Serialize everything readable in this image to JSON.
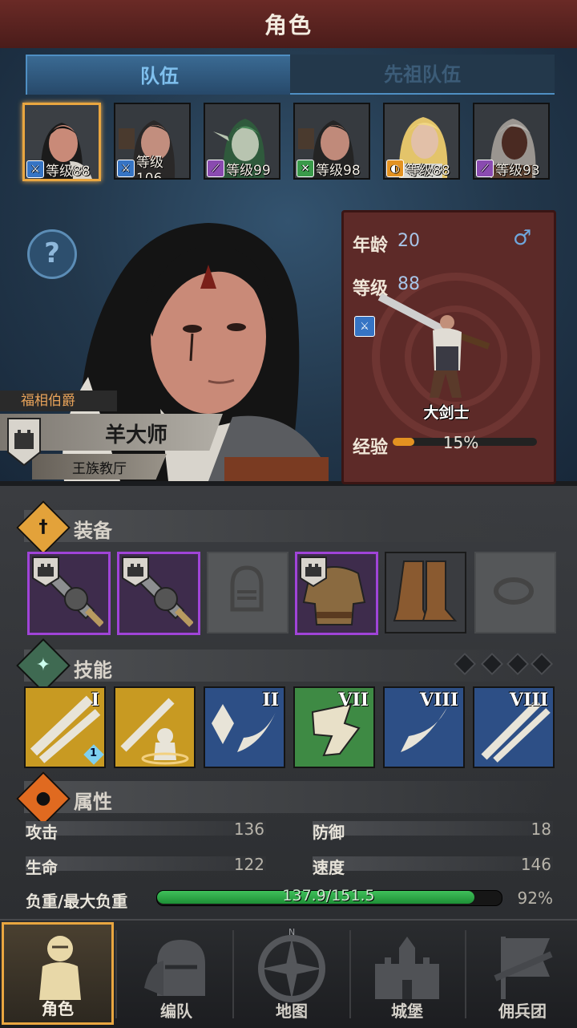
{
  "header": {
    "title": "角色"
  },
  "tabs": [
    {
      "label": "队伍",
      "active": true
    },
    {
      "label": "先祖队伍",
      "active": false
    }
  ],
  "party": [
    {
      "level_text": "等级88",
      "class_icon": "sword-icon",
      "class_color": "blue",
      "selected": true
    },
    {
      "level_text": "等级106",
      "class_icon": "sword-icon",
      "class_color": "blue",
      "selected": false
    },
    {
      "level_text": "等级99",
      "class_icon": "staff-icon",
      "class_color": "purple",
      "selected": false
    },
    {
      "level_text": "等级98",
      "class_icon": "crossed-swords-icon",
      "class_color": "green",
      "selected": false
    },
    {
      "level_text": "等级88",
      "class_icon": "shield-icon",
      "class_color": "orange",
      "selected": false
    },
    {
      "level_text": "等级93",
      "class_icon": "staff-icon",
      "class_color": "purple",
      "selected": false
    }
  ],
  "character": {
    "title": "福相伯爵",
    "name": "羊大师",
    "house": "王族教厅",
    "age_label": "年龄",
    "age": "20",
    "gender_icon": "male-icon",
    "level_label": "等级",
    "level": "88",
    "class_name": "大剑士",
    "exp_label": "经验",
    "exp_percent": "15%",
    "exp_fraction": 0.15
  },
  "equipment": {
    "label": "装备",
    "slots": [
      {
        "name": "greatsword",
        "rarity": "purple",
        "crest": true
      },
      {
        "name": "greatsword",
        "rarity": "purple",
        "crest": true
      },
      {
        "name": "helmet-empty",
        "rarity": "empty",
        "crest": false
      },
      {
        "name": "leather-armor",
        "rarity": "purple",
        "crest": true
      },
      {
        "name": "boots",
        "rarity": "normal",
        "crest": false
      },
      {
        "name": "ring-empty",
        "rarity": "empty",
        "crest": false
      }
    ]
  },
  "skills": {
    "label": "技能",
    "items": [
      {
        "rank": "I",
        "bg": "gold",
        "badge": "1"
      },
      {
        "rank": "",
        "bg": "gold",
        "badge": ""
      },
      {
        "rank": "II",
        "bg": "blue",
        "badge": ""
      },
      {
        "rank": "VII",
        "bg": "green",
        "badge": ""
      },
      {
        "rank": "VIII",
        "bg": "blue",
        "badge": ""
      },
      {
        "rank": "VIII",
        "bg": "blue",
        "badge": ""
      }
    ],
    "slot_count": 4
  },
  "attributes": {
    "label": "属性",
    "attack_label": "攻击",
    "attack": "136",
    "defense_label": "防御",
    "defense": "18",
    "hp_label": "生命",
    "hp": "122",
    "speed_label": "速度",
    "speed": "146",
    "load_label": "负重/最大负重",
    "load": "137.9/151.5",
    "load_percent": "92%",
    "load_fraction": 0.92
  },
  "nav": [
    {
      "label": "角色",
      "active": true
    },
    {
      "label": "编队",
      "active": false
    },
    {
      "label": "地图",
      "active": false
    },
    {
      "label": "城堡",
      "active": false
    },
    {
      "label": "佣兵团",
      "active": false
    }
  ],
  "colors": {
    "accent": "#e9a640",
    "tab_blue": "#4f8fc3",
    "rarity_purple": "#a044d8",
    "load_green": "#2fb04a"
  }
}
